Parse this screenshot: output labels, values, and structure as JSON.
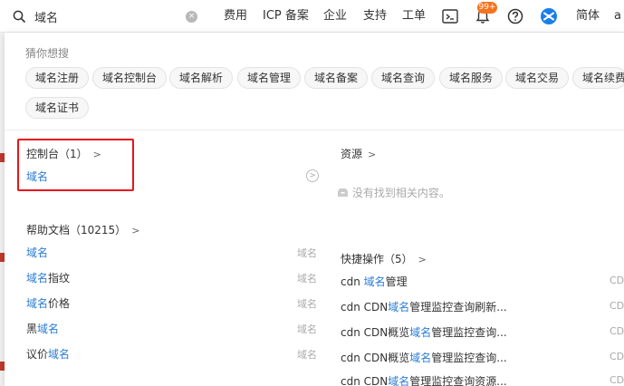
{
  "search": {
    "value": "域名",
    "clear_icon": "×"
  },
  "nav": {
    "items": [
      "费用",
      "ICP 备案",
      "企业",
      "支持",
      "工单"
    ],
    "badge": "99+",
    "lang": "简体",
    "avatar_char": "a",
    "icons": [
      "terminal-icon",
      "bell-icon",
      "help-icon",
      "app-icon"
    ]
  },
  "guess": {
    "title": "猜你想搜",
    "tags": [
      "域名注册",
      "域名控制台",
      "域名解析",
      "域名管理",
      "域名备案",
      "域名查询",
      "域名服务",
      "域名交易",
      "域名续费",
      "域名证书"
    ]
  },
  "console": {
    "title": "控制台（1）",
    "link": "域名"
  },
  "resources": {
    "title": "资源",
    "empty": "没有找到相关内容。"
  },
  "docs": {
    "title": "帮助文档（10215）",
    "items": [
      {
        "pre": "",
        "kw": "域名",
        "post": "",
        "tag": "域名"
      },
      {
        "pre": "",
        "kw": "域名",
        "post": "指纹",
        "tag": "域名"
      },
      {
        "pre": "",
        "kw": "域名",
        "post": "价格",
        "tag": "域名"
      },
      {
        "pre": "黑",
        "kw": "域名",
        "post": "",
        "tag": "域名"
      },
      {
        "pre": "议价",
        "kw": "域名",
        "post": "",
        "tag": "域名"
      }
    ]
  },
  "quick": {
    "title": "快捷操作（5）",
    "items": [
      {
        "pre": "cdn ",
        "kw": "域名",
        "post": "管理",
        "tag": "CD"
      },
      {
        "pre": "cdn CDN",
        "kw": "域名",
        "post": "管理监控查询刷新...",
        "tag": "CD"
      },
      {
        "pre": "cdn CDN概览",
        "kw": "域名",
        "post": "管理监控查询...",
        "tag": "CD"
      },
      {
        "pre": "cdn CDN概览",
        "kw": "域名",
        "post": "管理监控查询...",
        "tag": "CD"
      },
      {
        "pre": "cdn CDN",
        "kw": "域名",
        "post": "管理监控查询资源...",
        "tag": "CD"
      }
    ]
  }
}
